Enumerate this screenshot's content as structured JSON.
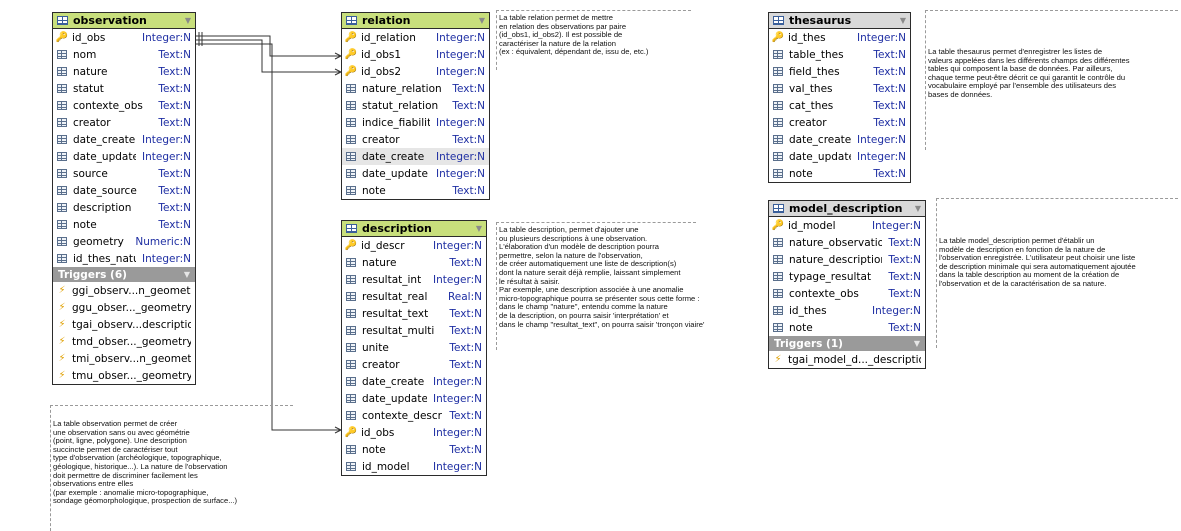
{
  "entities": {
    "observation": {
      "title": "observation",
      "columns": [
        {
          "name": "id_obs",
          "type": "Integer:N",
          "kind": "key"
        },
        {
          "name": "nom",
          "type": "Text:N",
          "kind": "col"
        },
        {
          "name": "nature",
          "type": "Text:N",
          "kind": "col"
        },
        {
          "name": "statut",
          "type": "Text:N",
          "kind": "col"
        },
        {
          "name": "contexte_obs",
          "type": "Text:N",
          "kind": "col"
        },
        {
          "name": "creator",
          "type": "Text:N",
          "kind": "col"
        },
        {
          "name": "date_create",
          "type": "Integer:N",
          "kind": "col"
        },
        {
          "name": "date_update",
          "type": "Integer:N",
          "kind": "col"
        },
        {
          "name": "source",
          "type": "Text:N",
          "kind": "col"
        },
        {
          "name": "date_source",
          "type": "Text:N",
          "kind": "col"
        },
        {
          "name": "description",
          "type": "Text:N",
          "kind": "col"
        },
        {
          "name": "note",
          "type": "Text:N",
          "kind": "col"
        },
        {
          "name": "geometry",
          "type": "Numeric:N",
          "kind": "col"
        },
        {
          "name": "id_thes_nature",
          "type": "Integer:N",
          "kind": "col"
        }
      ],
      "triggers_label": "Triggers (6)",
      "triggers": [
        "ggi_observ...n_geometry",
        "ggu_obser..._geometry",
        "tgai_observ...description",
        "tmd_obser..._geometry",
        "tmi_observ...n_geometry",
        "tmu_obser..._geometry"
      ]
    },
    "relation": {
      "title": "relation",
      "columns": [
        {
          "name": "id_relation",
          "type": "Integer:N",
          "kind": "key"
        },
        {
          "name": "id_obs1",
          "type": "Integer:N",
          "kind": "fk"
        },
        {
          "name": "id_obs2",
          "type": "Integer:N",
          "kind": "fk"
        },
        {
          "name": "nature_relation",
          "type": "Text:N",
          "kind": "col"
        },
        {
          "name": "statut_relation",
          "type": "Text:N",
          "kind": "col"
        },
        {
          "name": "indice_fiabilite",
          "type": "Integer:N",
          "kind": "col"
        },
        {
          "name": "creator",
          "type": "Text:N",
          "kind": "col"
        },
        {
          "name": "date_create",
          "type": "Integer:N",
          "kind": "col",
          "selected": true
        },
        {
          "name": "date_update",
          "type": "Integer:N",
          "kind": "col"
        },
        {
          "name": "note",
          "type": "Text:N",
          "kind": "col"
        }
      ]
    },
    "description": {
      "title": "description",
      "columns": [
        {
          "name": "id_descr",
          "type": "Integer:N",
          "kind": "key"
        },
        {
          "name": "nature",
          "type": "Text:N",
          "kind": "col"
        },
        {
          "name": "resultat_int",
          "type": "Integer:N",
          "kind": "col"
        },
        {
          "name": "resultat_real",
          "type": "Real:N",
          "kind": "col"
        },
        {
          "name": "resultat_text",
          "type": "Text:N",
          "kind": "col"
        },
        {
          "name": "resultat_multi",
          "type": "Text:N",
          "kind": "col"
        },
        {
          "name": "unite",
          "type": "Text:N",
          "kind": "col"
        },
        {
          "name": "creator",
          "type": "Text:N",
          "kind": "col"
        },
        {
          "name": "date_create",
          "type": "Integer:N",
          "kind": "col"
        },
        {
          "name": "date_update",
          "type": "Integer:N",
          "kind": "col"
        },
        {
          "name": "contexte_descr",
          "type": "Text:N",
          "kind": "col"
        },
        {
          "name": "id_obs",
          "type": "Integer:N",
          "kind": "fk"
        },
        {
          "name": "note",
          "type": "Text:N",
          "kind": "col"
        },
        {
          "name": "id_model",
          "type": "Integer:N",
          "kind": "col"
        }
      ]
    },
    "thesaurus": {
      "title": "thesaurus",
      "columns": [
        {
          "name": "id_thes",
          "type": "Integer:N",
          "kind": "key"
        },
        {
          "name": "table_thes",
          "type": "Text:N",
          "kind": "col"
        },
        {
          "name": "field_thes",
          "type": "Text:N",
          "kind": "col"
        },
        {
          "name": "val_thes",
          "type": "Text:N",
          "kind": "col"
        },
        {
          "name": "cat_thes",
          "type": "Text:N",
          "kind": "col"
        },
        {
          "name": "creator",
          "type": "Text:N",
          "kind": "col"
        },
        {
          "name": "date_create",
          "type": "Integer:N",
          "kind": "col"
        },
        {
          "name": "date_update",
          "type": "Integer:N",
          "kind": "col"
        },
        {
          "name": "note",
          "type": "Text:N",
          "kind": "col"
        }
      ]
    },
    "model_description": {
      "title": "model_description",
      "columns": [
        {
          "name": "id_model",
          "type": "Integer:N",
          "kind": "key"
        },
        {
          "name": "nature_observation",
          "type": "Text:N",
          "kind": "col"
        },
        {
          "name": "nature_description",
          "type": "Text:N",
          "kind": "col"
        },
        {
          "name": "typage_resultat",
          "type": "Text:N",
          "kind": "col"
        },
        {
          "name": "contexte_obs",
          "type": "Text:N",
          "kind": "col"
        },
        {
          "name": "id_thes",
          "type": "Integer:N",
          "kind": "col"
        },
        {
          "name": "note",
          "type": "Text:N",
          "kind": "col"
        }
      ],
      "triggers_label": "Triggers (1)",
      "triggers": [
        "tgai_model_d..._description"
      ]
    }
  },
  "notes": {
    "relation_note": "La table relation permet de mettre\nen relation des observations par paire\n(id_obs1, id_obs2). Il est possible de\ncaractériser la nature de la relation\n(ex : équivalent, dépendant de, issu de, etc.)",
    "description_note": "La table description, permet d'ajouter une\nou plusieurs descriptions à une observation.\nL'élaboration d'un modèle de description pourra\npermettre, selon la nature de l'observation,\nde créer automatiquement une liste de description(s)\ndont la nature serait déjà remplie, laissant simplement\nle résultat à saisir.\nPar exemple, une description associée à une anomalie\nmicro-topographique pourra se présenter sous cette forme :\ndans le champ \"nature\", entendu comme la nature\nde la description, on pourra saisir 'interprétation' et\ndans le champ \"resultat_text\", on pourra saisir 'tronçon viaire'",
    "thesaurus_note": "La table thesaurus permet d'enregistrer les listes de\nvaleurs appelées dans les différents champs des différentes\ntables qui composent la base de données. Par ailleurs,\nchaque terme peut-être décrit ce qui garantit le contrôle du\nvocabulaire employé par l'ensemble des utilisateurs des\nbases de données.",
    "model_note": "La table model_description permet d'établir un\nmodèle de description en fonction de la nature de\nl'observation enregistrée. L'utilisateur peut choisir une liste\nde description minimale qui sera automatiquement ajoutée\ndans la table description au moment de la création de\nl'observation et de la caractérisation de sa nature.",
    "observation_note": "La table observation permet de créer\nune observation sans ou avec géométrie\n(point, ligne, polygone). Une description\nsuccincte permet de caractériser tout\ntype d'observation (archéologique, topographique,\ngéologique, historique...). La nature de l'observation\ndoit permettre de discriminer facilement les\nobservations entre elles\n(par exemple : anomalie micro-topographique,\nsondage géomorphologique, prospection de surface...)"
  },
  "colors": {
    "header_green": "#c8df7c",
    "header_gray": "#d9d9d9",
    "type_blue": "#1f2fa3",
    "trigger_bar": "#9a9a9a"
  },
  "icons": {
    "table": "table-icon",
    "primary_key": "key-icon",
    "foreign_key": "foreign-key-icon",
    "column": "column-icon",
    "trigger": "lightning-icon",
    "collapse": "chevron-down-icon"
  }
}
